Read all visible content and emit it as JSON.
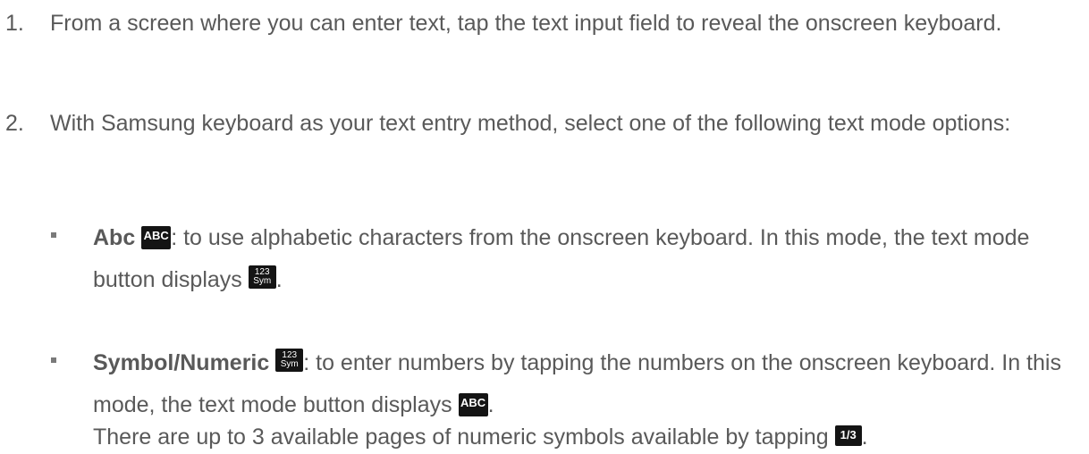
{
  "step1": {
    "number": "1.",
    "text": "From a screen where you can enter text, tap the text input field to reveal the onscreen keyboard."
  },
  "step2": {
    "number": "2.",
    "text": "With Samsung keyboard as your text entry method, select one of the following text mode options:"
  },
  "bullets": {
    "abc": {
      "label": "Abc",
      "text_a": ": to use alphabetic characters from the onscreen keyboard. In this mode, the text mode button displays ",
      "text_b": "."
    },
    "symbol": {
      "label": "Symbol/Numeric",
      "text_a": ": to enter numbers by tapping the numbers on the onscreen keyboard. In this mode, the text mode button displays ",
      "text_b": ".",
      "note_a": "There are up to 3 available pages of numeric symbols available by tapping ",
      "note_b": "."
    }
  },
  "icons": {
    "abc_key": "ABC",
    "sym_key_top": "123",
    "sym_key_bottom": "Sym",
    "page_key": "1/3"
  },
  "colors": {
    "text": "#595959",
    "key_background": "#141414",
    "key_text": "#ffffff"
  }
}
